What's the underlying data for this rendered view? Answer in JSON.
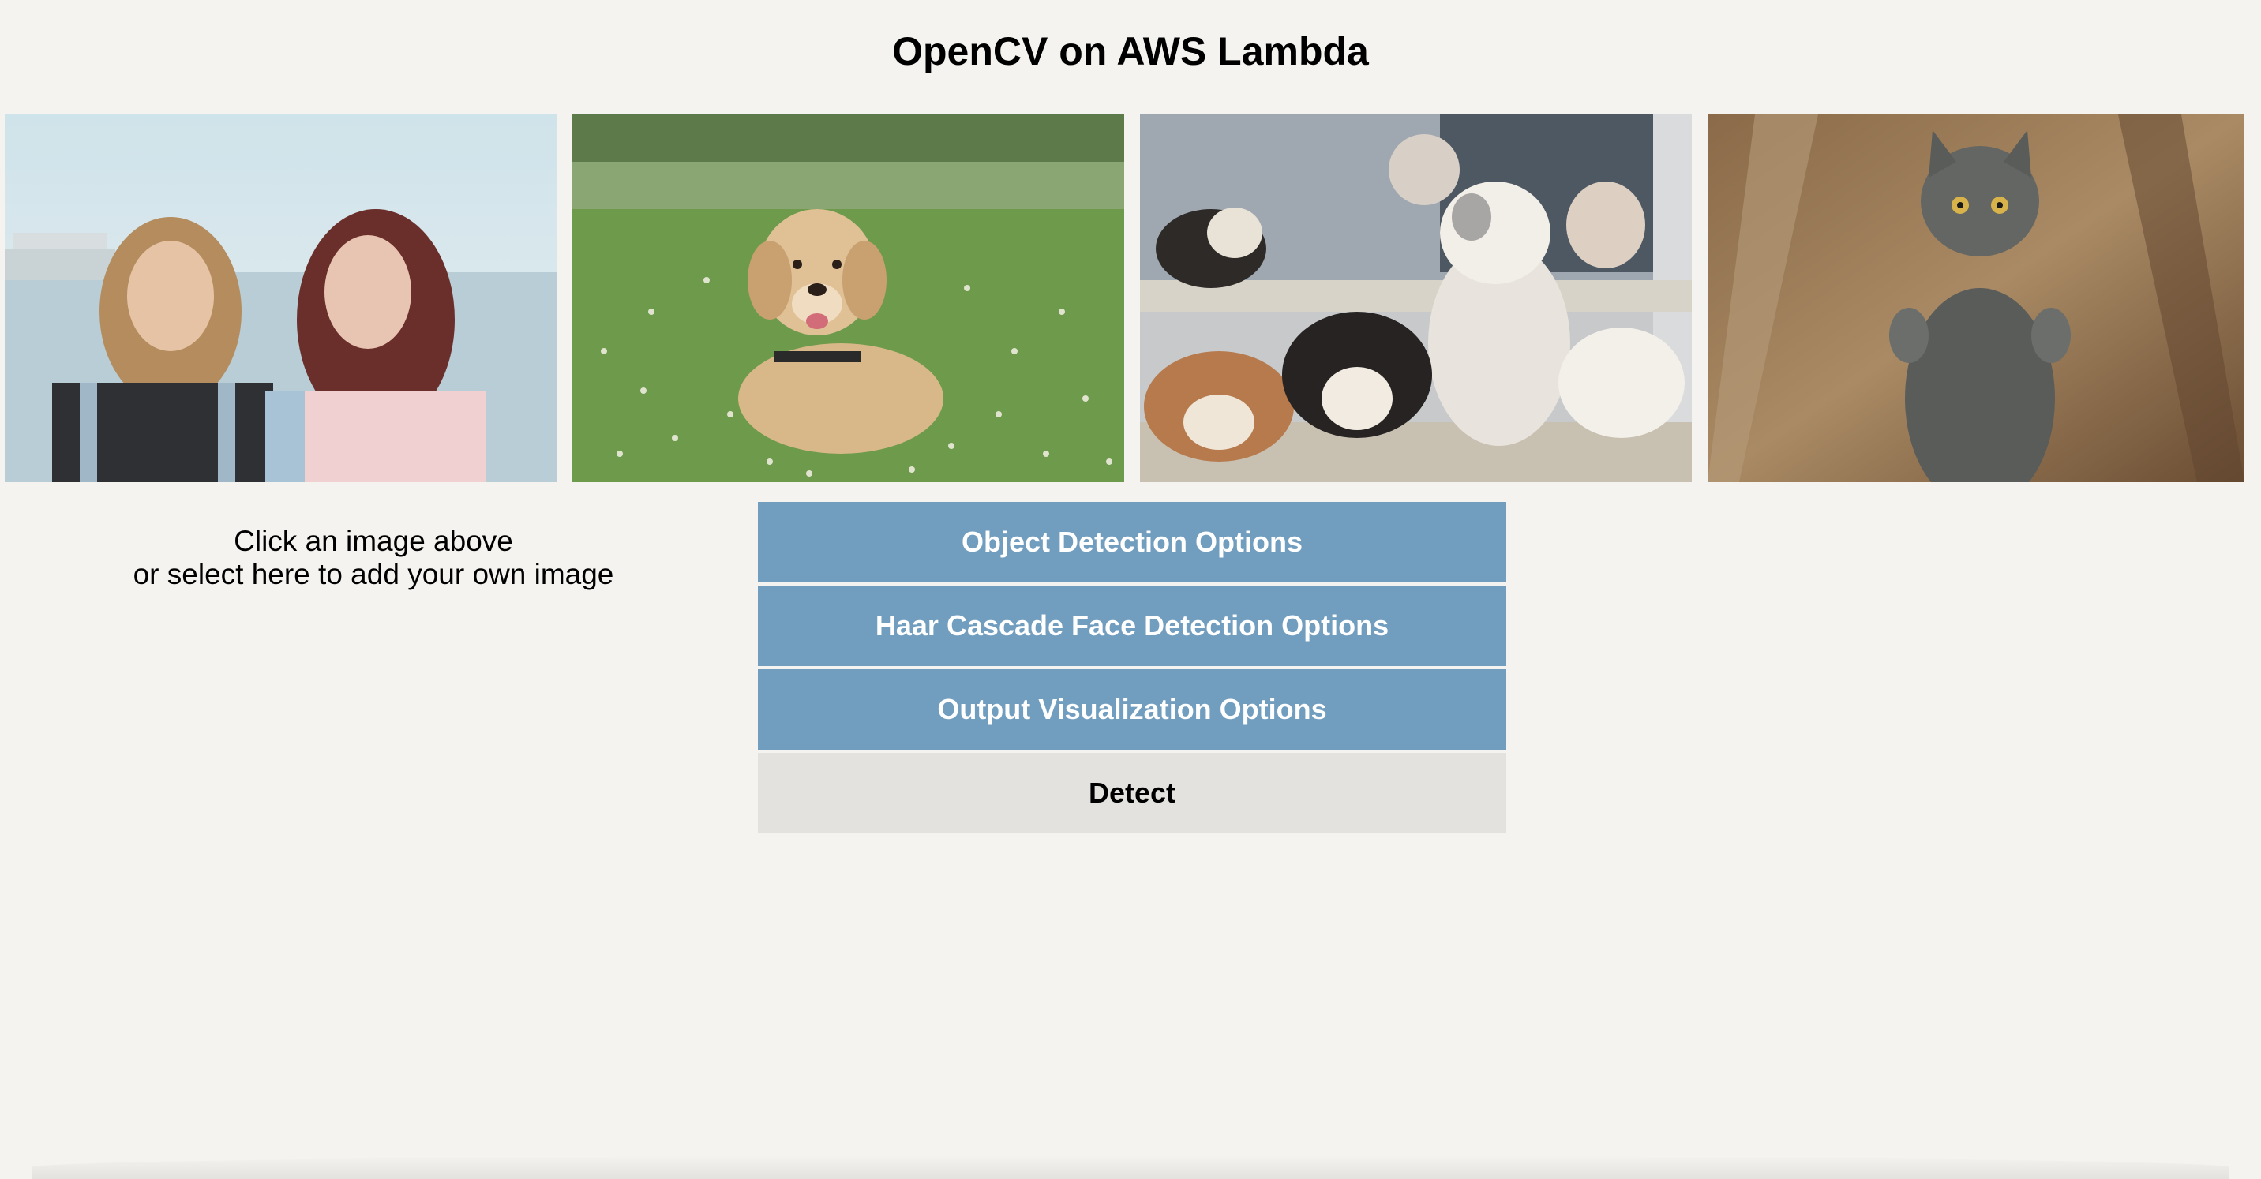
{
  "page": {
    "title": "OpenCV on AWS Lambda"
  },
  "gallery": {
    "images": [
      {
        "name": "two-women-photo"
      },
      {
        "name": "golden-retriever-photo"
      },
      {
        "name": "puppies-photo"
      },
      {
        "name": "gray-cat-photo"
      }
    ]
  },
  "upload": {
    "line1": "Click an image above",
    "line2": "or select here to add your own image"
  },
  "options": {
    "object_detection": "Object Detection Options",
    "haar_cascade": "Haar Cascade Face Detection Options",
    "output_visualization": "Output Visualization Options",
    "detect": "Detect"
  },
  "colors": {
    "background": "#f4f3ef",
    "option_button": "#719dbf",
    "detect_button": "#e3e2de"
  }
}
